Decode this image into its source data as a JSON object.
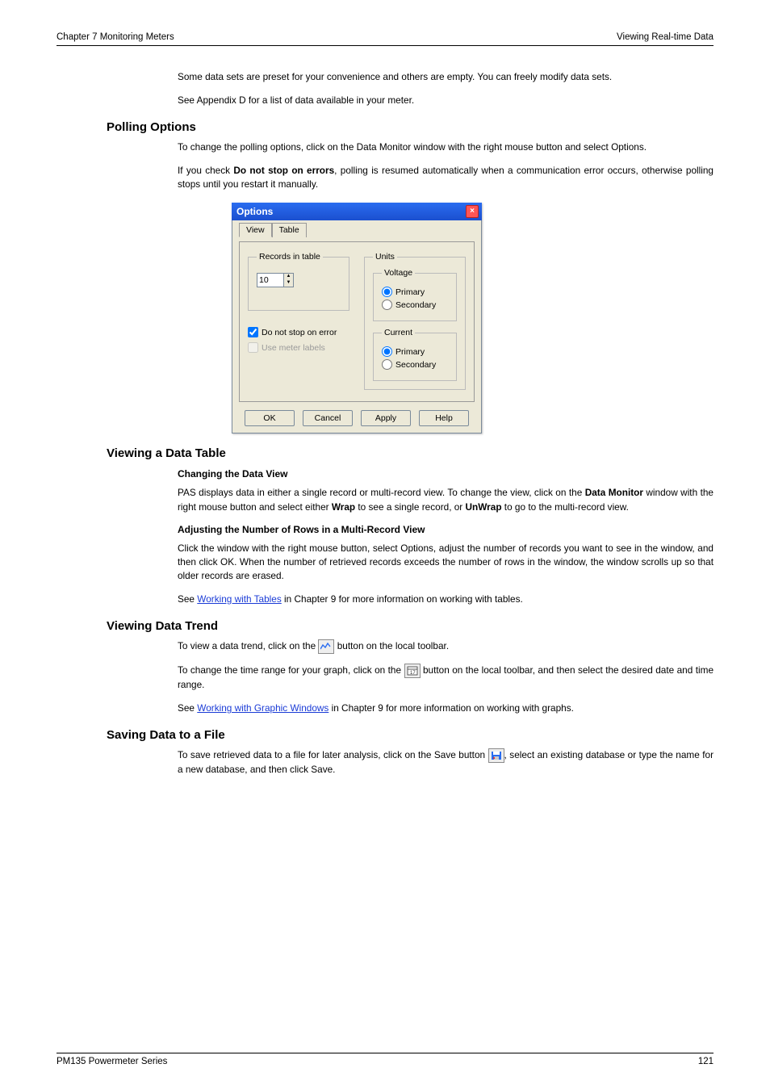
{
  "header": {
    "left": "Chapter 7   Monitoring Meters",
    "right": "Viewing Real-time Data"
  },
  "intro": {
    "p1": "Some data sets are preset for your convenience and others are empty. You can freely modify data sets.",
    "p2": "See Appendix D for a list of data available in your meter."
  },
  "polling": {
    "title": "Polling Options",
    "p1": "To change the polling options, click on the Data Monitor window with the right mouse button and select Options.",
    "p2a": "If you check ",
    "p2bold": "Do not stop on errors",
    "p2b": ", polling is resumed automatically when a communication error occurs, otherwise polling stops until you restart it manually."
  },
  "dialog": {
    "title": "Options",
    "tabs": {
      "view": "View",
      "table": "Table"
    },
    "records_legend": "Records in table",
    "records_value": "10",
    "units_legend": "Units",
    "voltage_legend": "Voltage",
    "voltage_primary": "Primary",
    "voltage_secondary": "Secondary",
    "current_legend": "Current",
    "current_primary": "Primary",
    "current_secondary": "Secondary",
    "chk_stop": "Do not stop on error",
    "chk_labels": "Use meter labels",
    "btn_ok": "OK",
    "btn_cancel": "Cancel",
    "btn_apply": "Apply",
    "btn_help": "Help"
  },
  "datatable": {
    "title": "Viewing a Data Table",
    "sub1": "Changing the Data View",
    "p1a": "PAS displays data in either a single record or multi-record view. To change the view, click on the ",
    "p1b1": "Data Monitor",
    "p1c": " window with the right mouse button and select either ",
    "p1b2": "Wrap",
    "p1d": " to see a single record, or ",
    "p1b3": "UnWrap",
    "p1e": " to go to the multi-record view.",
    "sub2": "Adjusting the Number of Rows in a Multi-Record View",
    "p2": "Click the window with the right mouse button, select Options, adjust the number of records you want to see in the window, and then click OK. When the number of retrieved records exceeds the number of rows in the window, the window scrolls up so that older records are erased.",
    "p3a": "See ",
    "p3link": "Working with Tables",
    "p3b": " in Chapter 9 for more information on working with tables."
  },
  "trend": {
    "title": "Viewing Data Trend",
    "p1a": "To view a data trend, click on the ",
    "p1b": " button on the local toolbar.",
    "p2a": "To change the time range for your graph, click on the ",
    "p2b": " button on the local toolbar, and then select the desired date and time range.",
    "p3a": "See ",
    "p3link": "Working with Graphic Windows",
    "p3b": " in Chapter 9 for more information on working with graphs."
  },
  "save": {
    "title": "Saving Data to a File",
    "p1a": "To save retrieved data to a file for later analysis, click on the Save button ",
    "p1b": ", select an existing database or type the name for a new database, and then click Save."
  },
  "footer": {
    "left": "PM135 Powermeter Series",
    "right": "121"
  }
}
